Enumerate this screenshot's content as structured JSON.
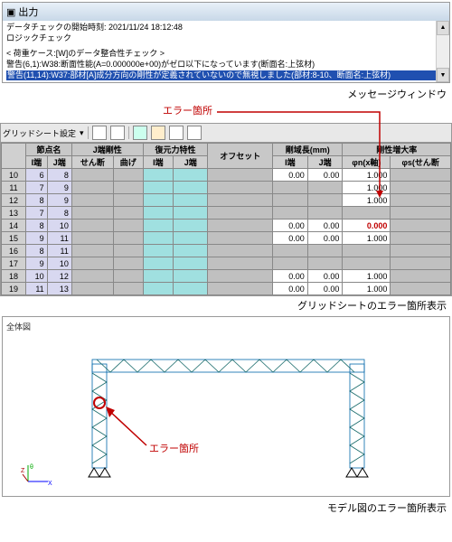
{
  "msgwin": {
    "title": "出力",
    "line1": "データチェックの開始時刻: 2021/11/24 18:12:48",
    "line2": "ロジックチェック",
    "line3": "< 荷重ケース:[W]のデータ整合性チェック >",
    "line4": "警告(6,1):W38:断面性能(A=0.000000e+00)がゼロ以下になっています(断面名:上弦材)",
    "line5_hl": "警告(11,14):W37:部材[A]成分方向の剛性が定義されていないので無視しました(部材:8-10、断面名:上弦材)"
  },
  "captions": {
    "msg": "メッセージウィンドウ",
    "grid": "グリッドシートのエラー箇所表示",
    "model": "モデル図のエラー箇所表示"
  },
  "annotations": {
    "err1": "エラー箇所",
    "err2": "エラー箇所"
  },
  "toolbar": {
    "label": "グリッドシート設定",
    "dd": "▾"
  },
  "grid": {
    "h_node": "節点名",
    "h_i": "I端",
    "h_j": "J端",
    "h_jrigid": "J端剛性",
    "h_shear": "せん断",
    "h_bend": "曲げ",
    "h_rest": "復元力特性",
    "h_ri": "I端",
    "h_rj": "J端",
    "h_offset": "オフセット",
    "h_rigidlen": "剛域長(mm)",
    "h_rli": "I端",
    "h_rlj": "J端",
    "h_zoka": "剛性増大率",
    "h_phin": "φn(x軸)",
    "h_phis": "φs(せん断",
    "rows": [
      {
        "n": "10",
        "i": "6",
        "j": "8",
        "rli": "0.00",
        "rlj": "0.00",
        "pn": "1.000"
      },
      {
        "n": "11",
        "i": "7",
        "j": "9",
        "pn": "1.000"
      },
      {
        "n": "12",
        "i": "8",
        "j": "9",
        "pn": "1.000"
      },
      {
        "n": "13",
        "i": "7",
        "j": "8",
        "pn": ""
      },
      {
        "n": "14",
        "i": "8",
        "j": "10",
        "rli": "0.00",
        "rlj": "0.00",
        "pn": "0.000",
        "err": true
      },
      {
        "n": "15",
        "i": "9",
        "j": "11",
        "rli": "0.00",
        "rlj": "0.00",
        "pn": "1.000"
      },
      {
        "n": "16",
        "i": "8",
        "j": "11",
        "pn": ""
      },
      {
        "n": "17",
        "i": "9",
        "j": "10",
        "pn": ""
      },
      {
        "n": "18",
        "i": "10",
        "j": "12",
        "rli": "0.00",
        "rlj": "0.00",
        "pn": "1.000"
      },
      {
        "n": "19",
        "i": "11",
        "j": "13",
        "rli": "0.00",
        "rlj": "0.00",
        "pn": "1.000"
      }
    ]
  },
  "model": {
    "title": "全体図"
  }
}
